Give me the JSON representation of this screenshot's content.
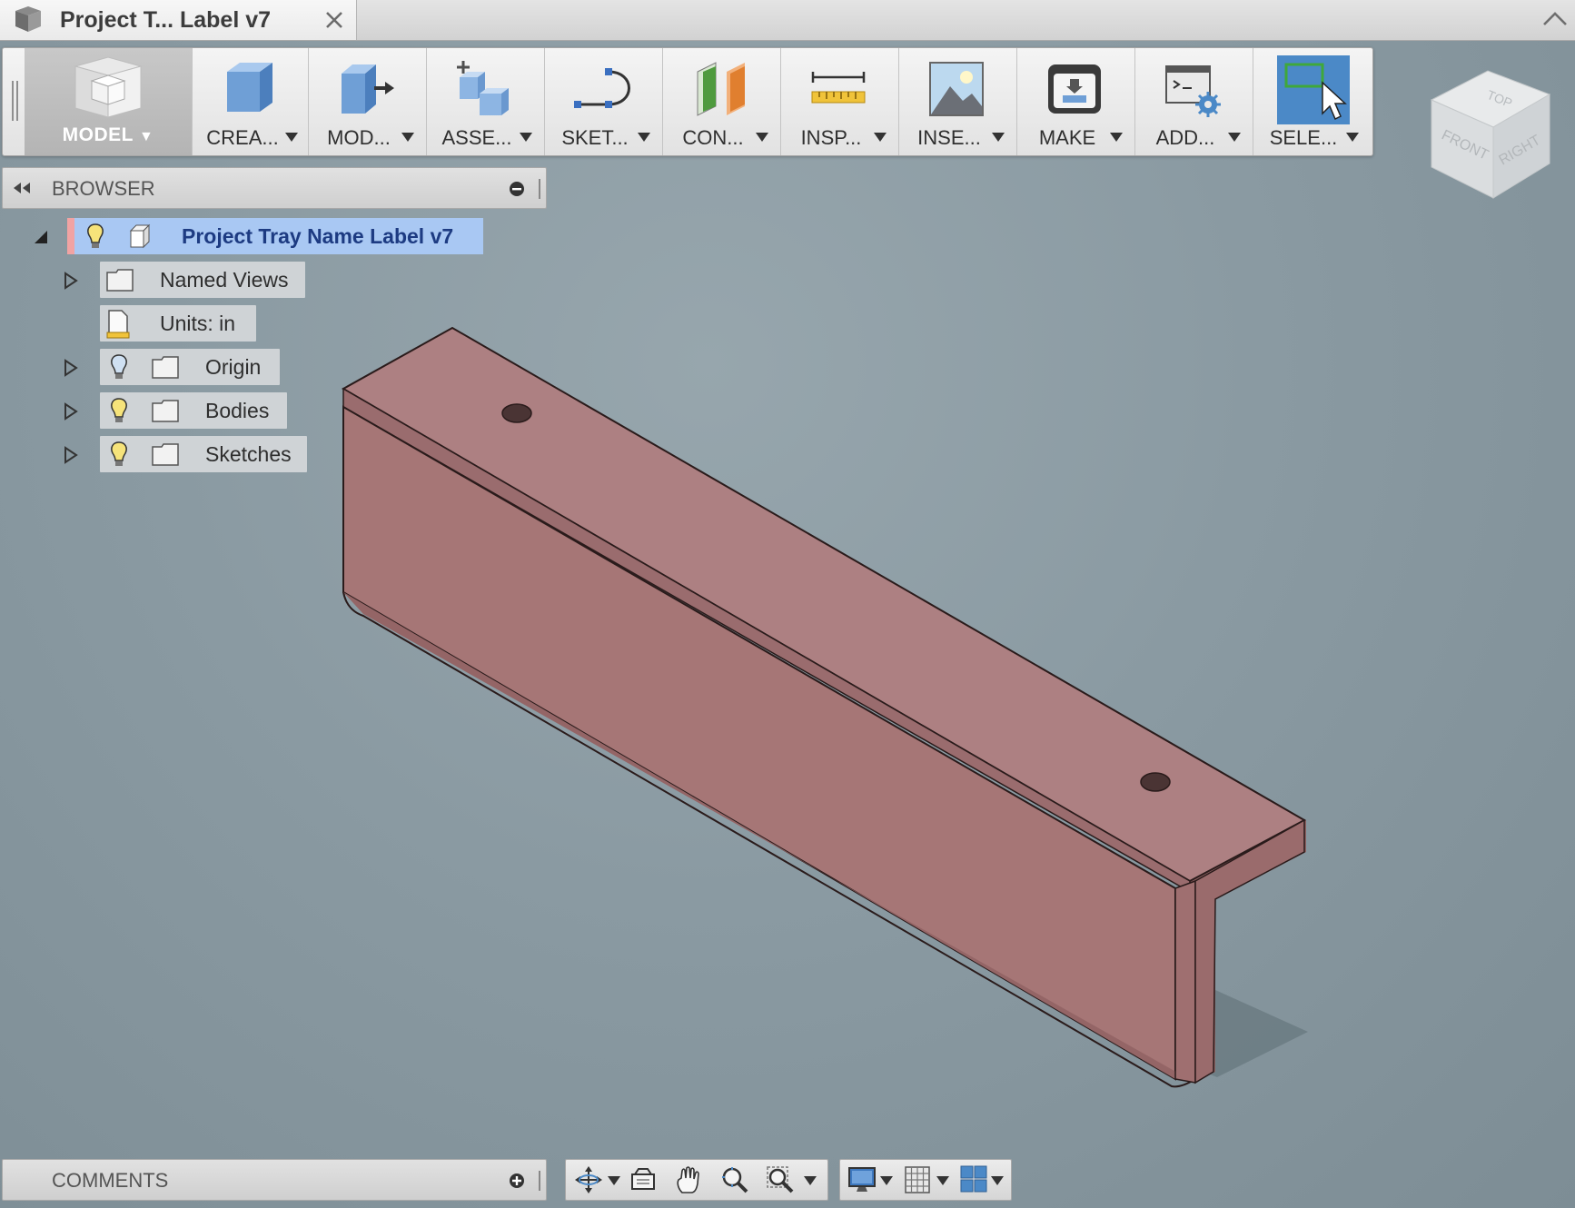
{
  "window": {
    "tab_title": "Project T... Label v7",
    "tab_icon": "box-icon"
  },
  "toolbar": {
    "workspace_label": "MODEL",
    "tools": [
      {
        "label": "CREA...",
        "icon": "create-box-icon"
      },
      {
        "label": "MOD...",
        "icon": "modify-icon"
      },
      {
        "label": "ASSE...",
        "icon": "assemble-icon"
      },
      {
        "label": "SKET...",
        "icon": "sketch-icon"
      },
      {
        "label": "CON...",
        "icon": "construct-planes-icon"
      },
      {
        "label": "INSP...",
        "icon": "measure-ruler-icon"
      },
      {
        "label": "INSE...",
        "icon": "insert-image-icon"
      },
      {
        "label": "MAKE",
        "icon": "3d-print-icon"
      },
      {
        "label": "ADD...",
        "icon": "scripts-addins-icon"
      },
      {
        "label": "SELE...",
        "icon": "select-window-icon"
      }
    ]
  },
  "browser": {
    "title": "BROWSER",
    "root": {
      "label": "Project Tray Name Label v7"
    },
    "items": [
      {
        "label": "Named Views",
        "expandable": true,
        "visibility_bulb": false
      },
      {
        "label": "Units: in",
        "expandable": false,
        "visibility_bulb": false
      },
      {
        "label": "Origin",
        "expandable": true,
        "visibility_bulb": true,
        "bulb_on": false
      },
      {
        "label": "Bodies",
        "expandable": true,
        "visibility_bulb": true,
        "bulb_on": true
      },
      {
        "label": "Sketches",
        "expandable": true,
        "visibility_bulb": true,
        "bulb_on": true
      }
    ]
  },
  "viewcube": {
    "faces": [
      "TOP",
      "FRONT",
      "RIGHT"
    ]
  },
  "comments": {
    "title": "COMMENTS"
  },
  "colors": {
    "model_fill": "#a87777",
    "model_top": "#ae8183",
    "canvas": "#8b9ba3",
    "selection": "#a9c8f3",
    "select_accent": "#4b89c7"
  }
}
